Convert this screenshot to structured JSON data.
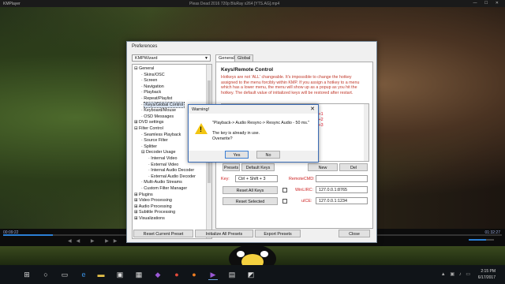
{
  "player": {
    "app_title": "KMPlayer",
    "file_title": "Pleas Dead 2016 720p BluRay x264 [YTS.AG].mp4",
    "window_buttons": "—  ☐  ✕",
    "elapsed": "00:09:22",
    "total": "01:32:27",
    "progress": 0.1
  },
  "preferences": {
    "title": "Preferences",
    "preset": "KMPWizard",
    "tabs": [
      "General",
      "Global"
    ],
    "tree": [
      {
        "label": "General",
        "indent": 0,
        "exp": "⊟"
      },
      {
        "label": "Skins/OSC",
        "indent": 1
      },
      {
        "label": "Screen",
        "indent": 1
      },
      {
        "label": "Navigation",
        "indent": 1
      },
      {
        "label": "Playback",
        "indent": 1
      },
      {
        "label": "Repeat/Playlist",
        "indent": 1
      },
      {
        "label": "Keys/Global Control",
        "indent": 1,
        "selected": true
      },
      {
        "label": "Keyboard/Mouse",
        "indent": 1
      },
      {
        "label": "OSD Messages",
        "indent": 1
      },
      {
        "label": "DVD settings",
        "indent": 0,
        "exp": "⊞"
      },
      {
        "label": "Filter Control",
        "indent": 0,
        "exp": "⊟"
      },
      {
        "label": "Seamless Playback",
        "indent": 1
      },
      {
        "label": "Source Filter",
        "indent": 1
      },
      {
        "label": "Splitter",
        "indent": 1
      },
      {
        "label": "Decoder Usage",
        "indent": 1,
        "exp": "⊟"
      },
      {
        "label": "Internal Video",
        "indent": 2
      },
      {
        "label": "External Video",
        "indent": 2
      },
      {
        "label": "Internal Audio Decoder",
        "indent": 2
      },
      {
        "label": "External Audio Decoder",
        "indent": 2
      },
      {
        "label": "Multi-Audio Streams",
        "indent": 1
      },
      {
        "label": "Custom Filter Manager",
        "indent": 1
      },
      {
        "label": "Plugins",
        "indent": 0,
        "exp": "⊞"
      },
      {
        "label": "Video Processing",
        "indent": 0,
        "exp": "⊞"
      },
      {
        "label": "Audio Processing",
        "indent": 0,
        "exp": "⊞"
      },
      {
        "label": "Subtitle Processing",
        "indent": 0,
        "exp": "⊞"
      },
      {
        "label": "Visualizations",
        "indent": 0,
        "exp": "⊞"
      }
    ],
    "keys": {
      "heading": "Keys/Remote Control",
      "description": "Hotkeys are not 'ALL' changeable. It's impossible to change the hotkey assigned to the menu forcibly within KMP. If you assign a hotkey to a menu which has a lower menu, the menu will show up as a popup as you hit the hotkey. The default value of initialized keys will be restored after restart.",
      "list_fragments": [
        "trl+1",
        "trl+2",
        "trl+3"
      ],
      "preset_btn": "Presets",
      "default_keys": "Default Keys",
      "new_btn": "New",
      "del_btn": "Del",
      "key_label": "Key:",
      "key_value": "Ctrl + Shift + 3",
      "remote_label": "RemoteCMD:",
      "reset_all": "Reset All Keys",
      "reset_selected": "Reset Selected",
      "winlirc_label": "WinLIRC:",
      "winlirc_value": "127.0.0.1:8765",
      "uice_label": "uICE:",
      "uice_value": "127.0.0.1:1234"
    },
    "footer": {
      "reset_current": "Reset Current Preset",
      "init_all": "Initialize All Presets",
      "export": "Export Presets",
      "close": "Close"
    }
  },
  "warning": {
    "title": "Warning!",
    "line1": "\"Playback-> Audio Resync-> Resync Audio - 50 ms.\"",
    "line2": "The key is already in use.",
    "line3": "Overwrite?",
    "yes": "Yes",
    "no": "No"
  },
  "taskbar": {
    "time": "2:15 PM",
    "date": "6/17/2017",
    "icons": [
      "windows-start-icon",
      "search-icon",
      "task-view-icon",
      "edge-icon",
      "file-explorer-icon",
      "store-icon",
      "photos-icon",
      "visual-studio-icon",
      "chrome-icon",
      "firefox-icon",
      "kmplayer-icon",
      "media-icon",
      "game-icon"
    ]
  }
}
